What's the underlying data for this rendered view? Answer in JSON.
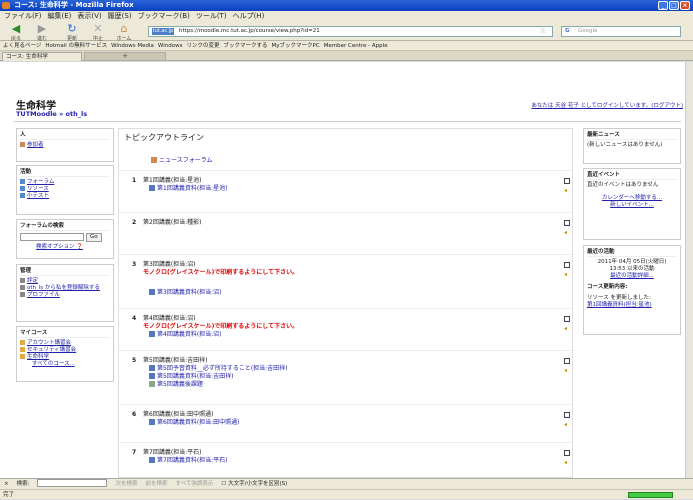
{
  "window": {
    "title": "コース: 生命科学 - Mozilla Firefox"
  },
  "menu": [
    "ファイル(F)",
    "編集(E)",
    "表示(V)",
    "履歴(S)",
    "ブックマーク(B)",
    "ツール(T)",
    "ヘルプ(H)"
  ],
  "nav": {
    "back": "戻る",
    "forward": "進む",
    "reload": "更新",
    "stop": "中止",
    "home": "ホーム",
    "url": "https://moodle.mc.tut.ac.jp/course/view.php?id=21",
    "search_placeholder": "Google"
  },
  "bookmarks": [
    "よく見るページ",
    "Hotmail の無料サービス",
    "Windows Media",
    "Windows",
    "リンクの変更",
    "ブックマークする",
    "MyブックマークPC",
    "Member Centre - Apple"
  ],
  "tab": {
    "label": "コース: 生命科学",
    "newtab": "+"
  },
  "site": {
    "name": "生命科学",
    "login": "あなたは 天谷 花子 としてログインしています。(ログアウト)",
    "breadcrumb": "TUTMoodle » oth_ls"
  },
  "left": {
    "people": {
      "title": "人",
      "items": [
        "参加者"
      ]
    },
    "activities": {
      "title": "活動",
      "items": [
        "フォーラム",
        "リソース",
        "小テスト"
      ]
    },
    "forumsearch": {
      "title": "フォーラムの検索",
      "go": "Go",
      "advanced": "検索オプション"
    },
    "admin": {
      "title": "管理",
      "items": [
        "評定",
        "oth_ls から私を登録解除する",
        "プロファイル"
      ]
    },
    "mycourses": {
      "title": "マイコース",
      "items": [
        "アカウント講習会",
        "セキュリティ講習会",
        "生命科学"
      ],
      "all": "すべてのコース..."
    }
  },
  "main": {
    "heading": "トピックアウトライン",
    "news": "ニュースフォーラム",
    "topics": [
      {
        "num": "1",
        "title": "第1回講義(担当:星池)",
        "red": "",
        "items": [
          "第1回講義資料(担当:星池)"
        ]
      },
      {
        "num": "2",
        "title": "第2回講義(担当:種影)",
        "red": "",
        "items": []
      },
      {
        "num": "3",
        "title": "第3回講義(担当:沼)",
        "red": "モノクロ(グレイスケール)で印刷するようにして下さい。",
        "items": [
          "第3回講義資料(担当:沼)"
        ]
      },
      {
        "num": "4",
        "title": "第4回講義(担当:沼)",
        "red": "モノクロ(グレイスケール)で印刷するようにして下さい。",
        "items": [
          "第4回講義資料(担当:沼)"
        ]
      },
      {
        "num": "5",
        "title": "第5回講義(担当:吉田祥)",
        "red": "",
        "items": [
          "第5回予習資料__必ず所持すること(担当:吉田祥)",
          "第5回講義資料(担当:吉田祥)",
          "第5回講義後課題"
        ]
      },
      {
        "num": "6",
        "title": "第6回講義(担当:田中照通)",
        "red": "",
        "items": [
          "第6回講義資料(担当:田中照通)"
        ]
      },
      {
        "num": "7",
        "title": "第7回講義(担当:平石)",
        "red": "",
        "items": [
          "第7回講義資料(担当:平石)"
        ]
      }
    ]
  },
  "right": {
    "news": {
      "title": "最新ニュース",
      "text": "(新しいニュースはありません)"
    },
    "events": {
      "title": "直近イベント",
      "text": "直近のイベントはありません",
      "calendar": "カレンダーへ移動する...",
      "newevent": "新しいイベント..."
    },
    "activity": {
      "title": "最近の活動",
      "date": "2011年 04月 05日(火曜日)",
      "time": "13:53 以来の活動",
      "full": "最近の活動詳細...",
      "updates_title": "コース更新内容:",
      "updated": "リソース を更新しました:",
      "link": "第1回講義資料(担当:星池)"
    }
  },
  "findbar": {
    "close": "×",
    "label": "検索:",
    "next": "次を検索",
    "prev": "前を検索",
    "highlight": "すべて強調表示",
    "matchcase": "大文字/小文字を区別(S)"
  },
  "status": {
    "text": "完了"
  }
}
